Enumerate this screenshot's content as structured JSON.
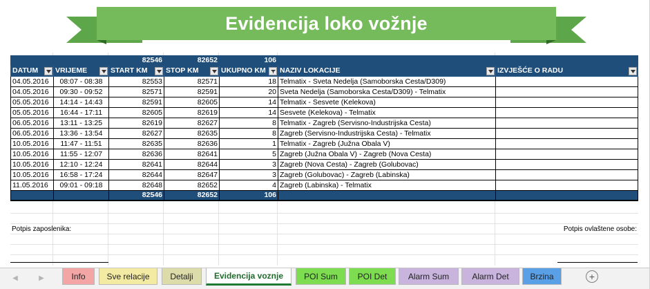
{
  "banner": {
    "title": "Evidencija loko vožnje"
  },
  "table": {
    "top_totals": {
      "start_km": "82546",
      "stop_km": "82652",
      "ukupno_km": "106"
    },
    "headers": {
      "datum": "DATUM",
      "vrijeme": "VRIJEME",
      "start_km": "START KM",
      "stop_km": "STOP KM",
      "ukupno_km": "UKUPNO KM",
      "naziv_lokacije": "NAZIV LOKACIJE",
      "izvjesce": "IZVJEŠĆE O RADU"
    },
    "rows": [
      {
        "datum": "04.05.2016",
        "vrijeme": "08:07 - 08:38",
        "start_km": "82553",
        "stop_km": "82571",
        "ukupno_km": "18",
        "naziv_lokacije": "Telmatix - Sveta Nedelja (Samoborska Cesta/D309)",
        "izvjesce": ""
      },
      {
        "datum": "04.05.2016",
        "vrijeme": "09:30 - 09:52",
        "start_km": "82571",
        "stop_km": "82591",
        "ukupno_km": "20",
        "naziv_lokacije": "Sveta Nedelja (Samoborska Cesta/D309) - Telmatix",
        "izvjesce": ""
      },
      {
        "datum": "05.05.2016",
        "vrijeme": "14:14 - 14:43",
        "start_km": "82591",
        "stop_km": "82605",
        "ukupno_km": "14",
        "naziv_lokacije": "Telmatix - Sesvete (Kelekova)",
        "izvjesce": ""
      },
      {
        "datum": "05.05.2016",
        "vrijeme": "16:44 - 17:11",
        "start_km": "82605",
        "stop_km": "82619",
        "ukupno_km": "14",
        "naziv_lokacije": "Sesvete (Kelekova) - Telmatix",
        "izvjesce": ""
      },
      {
        "datum": "06.05.2016",
        "vrijeme": "13:11 - 13:25",
        "start_km": "82619",
        "stop_km": "82627",
        "ukupno_km": "8",
        "naziv_lokacije": "Telmatix - Zagreb (Servisno-Industrijska Cesta)",
        "izvjesce": ""
      },
      {
        "datum": "06.05.2016",
        "vrijeme": "13:36 - 13:54",
        "start_km": "82627",
        "stop_km": "82635",
        "ukupno_km": "8",
        "naziv_lokacije": "Zagreb (Servisno-Industrijska Cesta) - Telmatix",
        "izvjesce": ""
      },
      {
        "datum": "10.05.2016",
        "vrijeme": "11:47 - 11:51",
        "start_km": "82635",
        "stop_km": "82636",
        "ukupno_km": "1",
        "naziv_lokacije": "Telmatix - Zagreb (Južna Obala V)",
        "izvjesce": ""
      },
      {
        "datum": "10.05.2016",
        "vrijeme": "11:55 - 12:07",
        "start_km": "82636",
        "stop_km": "82641",
        "ukupno_km": "5",
        "naziv_lokacije": "Zagreb (Južna Obala V) - Zagreb (Nova Cesta)",
        "izvjesce": ""
      },
      {
        "datum": "10.05.2016",
        "vrijeme": "12:10 - 12:24",
        "start_km": "82641",
        "stop_km": "82644",
        "ukupno_km": "3",
        "naziv_lokacije": "Zagreb (Nova Cesta) - Zagreb (Golubovac)",
        "izvjesce": ""
      },
      {
        "datum": "10.05.2016",
        "vrijeme": "16:58 - 17:24",
        "start_km": "82644",
        "stop_km": "82647",
        "ukupno_km": "3",
        "naziv_lokacije": "Zagreb (Golubovac) - Zagreb (Labinska)",
        "izvjesce": ""
      },
      {
        "datum": "11.05.2016",
        "vrijeme": "09:01 - 09:18",
        "start_km": "82648",
        "stop_km": "82652",
        "ukupno_km": "4",
        "naziv_lokacije": "Zagreb (Labinska) - Telmatix",
        "izvjesce": ""
      }
    ],
    "bottom_totals": {
      "start_km": "82546",
      "stop_km": "82652",
      "ukupno_km": "106"
    }
  },
  "signatures": {
    "left": "Potpis zaposlenika:",
    "right": "Potpis ovlaštene osobe:"
  },
  "tabs": [
    {
      "label": "Info",
      "color": "#f4a5a5"
    },
    {
      "label": "Sve relacije",
      "color": "#f3eaa4"
    },
    {
      "label": "Detalji",
      "color": "#dcdcaa"
    },
    {
      "label": "Evidencija voznje",
      "color": "#ffffff"
    },
    {
      "label": "POI Sum",
      "color": "#7ddc4f"
    },
    {
      "label": "POI Det",
      "color": "#7ddc4f"
    },
    {
      "label": "Alarm Sum",
      "color": "#c8b4dc"
    },
    {
      "label": "Alarm Det",
      "color": "#c8b4dc"
    },
    {
      "label": "Brzina",
      "color": "#5aa0e6"
    }
  ],
  "add_sheet_icon": "plus-circle-icon"
}
